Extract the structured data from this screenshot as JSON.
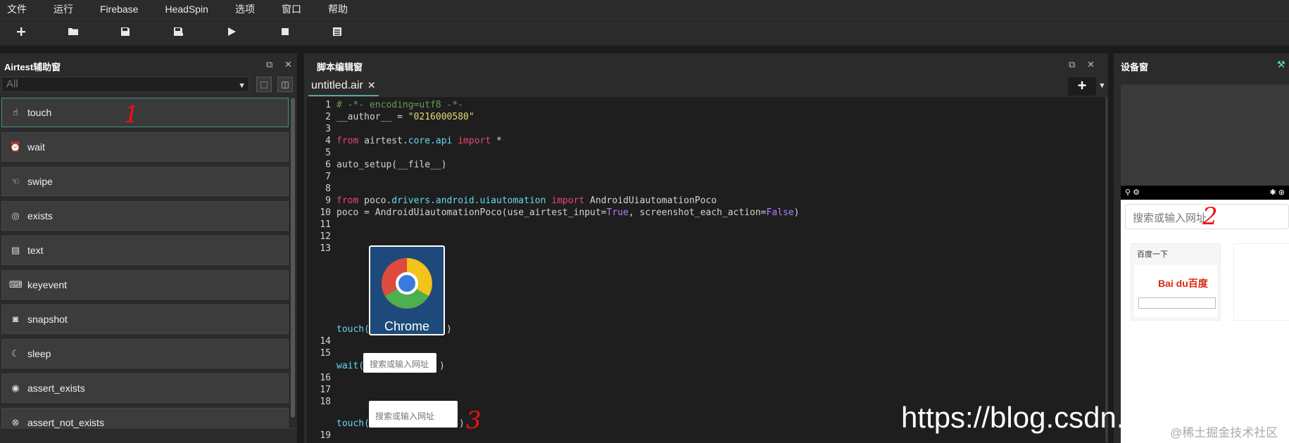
{
  "menubar": {
    "items": [
      "文件",
      "运行",
      "Firebase",
      "HeadSpin",
      "选项",
      "窗口",
      "帮助"
    ]
  },
  "toolbar": {
    "buttons": [
      "plus-icon",
      "folder-open-icon",
      "save-icon",
      "save-as-icon",
      "run-icon",
      "stop-icon",
      "log-icon"
    ]
  },
  "left_panel": {
    "title": "Airtest辅助窗",
    "filter_placeholder": "All",
    "items": [
      {
        "label": "touch",
        "icon": "hand-touch-icon"
      },
      {
        "label": "wait",
        "icon": "clock-icon"
      },
      {
        "label": "swipe",
        "icon": "hand-swipe-icon"
      },
      {
        "label": "exists",
        "icon": "check-circle-icon"
      },
      {
        "label": "text",
        "icon": "text-box-icon"
      },
      {
        "label": "keyevent",
        "icon": "keyboard-icon"
      },
      {
        "label": "snapshot",
        "icon": "camera-icon"
      },
      {
        "label": "sleep",
        "icon": "moon-icon"
      },
      {
        "label": "assert_exists",
        "icon": "target-icon"
      },
      {
        "label": "assert_not_exists",
        "icon": "x-circle-icon"
      }
    ]
  },
  "editor": {
    "title": "脚本编辑窗",
    "tab_label": "untitled.air",
    "lines": {
      "l1": "# -*- encoding=utf8 -*-",
      "l2_a": "__author__ = ",
      "l2_b": "\"0216000580\"",
      "l4_a": "from",
      "l4_b": " airtest.",
      "l4_c": "core.api",
      "l4_d": " import",
      "l4_e": " *",
      "l6": "auto_setup(__file__)",
      "l9_a": "from",
      "l9_b": " poco.",
      "l9_c": "drivers.android.uiautomation",
      "l9_d": " import",
      "l9_e": " AndroidUiautomationPoco",
      "l10_a": "poco = AndroidUiautomationPoco(use_airtest_input=",
      "l10_b": "True",
      "l10_c": ", screenshot_each_action=",
      "l10_d": "False",
      "l10_e": ")",
      "touch1": "touch(",
      "close1": ")",
      "wait1": "wait(",
      "close2": ")",
      "touch2": "touch(",
      "close3": ")"
    },
    "line_numbers": [
      "1",
      "2",
      "3",
      "4",
      "5",
      "6",
      "7",
      "8",
      "9",
      "10",
      "11",
      "12",
      "13",
      "14",
      "15",
      "16",
      "17",
      "18",
      "19"
    ],
    "chrome_image_label": "Chrome",
    "search_image_label": "搜索或输入网址"
  },
  "device_panel": {
    "title": "设备窗",
    "phone_search": "搜索或输入网址",
    "tile_title": "百度一下",
    "tile_logo": "Bai du百度"
  },
  "overlay": {
    "url": "https://blog.csdn.n",
    "watermark": "@稀土掘金技术社区"
  },
  "annotations": [
    "1",
    "2",
    "3"
  ]
}
